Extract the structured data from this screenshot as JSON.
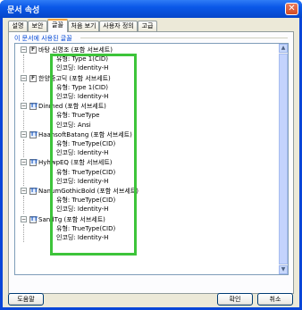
{
  "window": {
    "title": "문서 속성",
    "close_glyph": "✕"
  },
  "tabs": [
    {
      "label": "설명",
      "active": false
    },
    {
      "label": "보안",
      "active": false
    },
    {
      "label": "글꼴",
      "active": true
    },
    {
      "label": "처음 보기",
      "active": false
    },
    {
      "label": "사용자 정의",
      "active": false
    },
    {
      "label": "고급",
      "active": false
    }
  ],
  "group": {
    "label": "이 문서에 사용된 글꼴"
  },
  "fonts": [
    {
      "name": "바탕 신명조 (포함 서브세트)",
      "kind": "F",
      "props": [
        "유형: Type 1(CID)",
        "인코딩: Identity-H"
      ]
    },
    {
      "name": "한양중고딕 (포함 서브세트)",
      "kind": "F",
      "props": [
        "유형: Type 1(CID)",
        "인코딩: Identity-H"
      ]
    },
    {
      "name": "Dinmed (포함 서브세트)",
      "kind": "TT",
      "props": [
        "유형: TrueType",
        "인코딩: Ansi"
      ]
    },
    {
      "name": "HaansoftBatang (포함 서브세트)",
      "kind": "TT",
      "props": [
        "유형: TrueType(CID)",
        "인코딩: Identity-H"
      ]
    },
    {
      "name": "HyhwpEQ (포함 서브세트)",
      "kind": "TT",
      "props": [
        "유형: TrueType(CID)",
        "인코딩: Identity-H"
      ]
    },
    {
      "name": "NanumGothicBold (포함 서브세트)",
      "kind": "TT",
      "props": [
        "유형: TrueType(CID)",
        "인코딩: Identity-H"
      ]
    },
    {
      "name": "SandTg (포함 서브세트)",
      "kind": "TT",
      "props": [
        "유형: TrueType(CID)",
        "인코딩: Identity-H"
      ]
    }
  ],
  "buttons": {
    "help": "도움말",
    "ok": "확인",
    "cancel": "취소"
  },
  "colors": {
    "highlight": "#3dc43a",
    "title_bar": "#0a58e8",
    "group_label": "#0046d5"
  }
}
